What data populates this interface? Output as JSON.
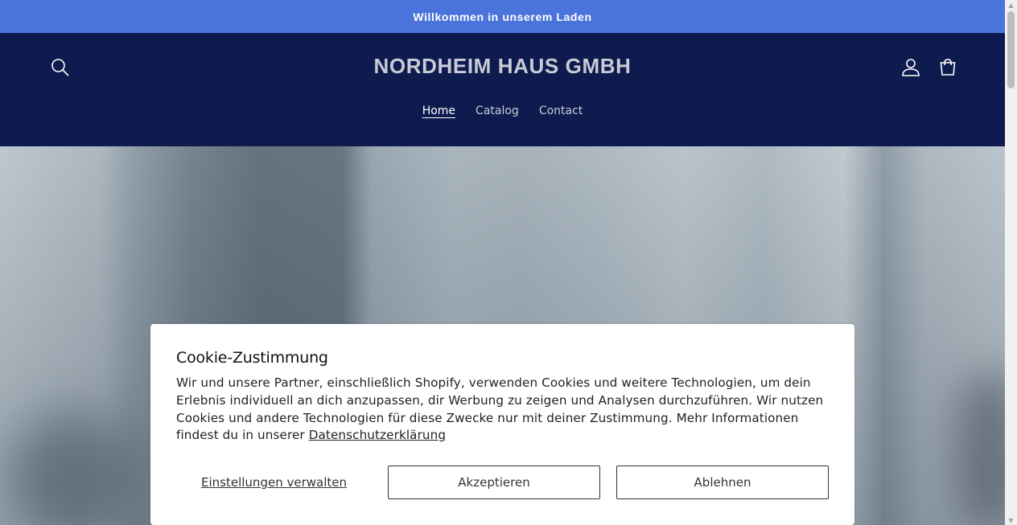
{
  "announcement": {
    "text": "Willkommen in unserem Laden"
  },
  "header": {
    "logo": "NORDHEIM HAUS GMBH",
    "icons": {
      "search": "search-icon",
      "account": "account-icon",
      "cart": "cart-icon"
    }
  },
  "nav": {
    "items": [
      {
        "label": "Home",
        "active": true
      },
      {
        "label": "Catalog",
        "active": false
      },
      {
        "label": "Contact",
        "active": false
      }
    ]
  },
  "cookie": {
    "title": "Cookie-Zustimmung",
    "body": "Wir und unsere Partner, einschließlich Shopify, verwenden Cookies und weitere Technologien, um dein Erlebnis individuell an dich anzupassen, dir Werbung zu zeigen und Analysen durchzuführen. Wir nutzen Cookies und andere Technologien für diese Zwecke nur mit deiner Zustimmung. Mehr Informationen findest du in unserer",
    "privacy_link": "Datenschutzerklärung",
    "manage_label": "Einstellungen verwalten",
    "accept_label": "Akzeptieren",
    "decline_label": "Ablehnen"
  },
  "colors": {
    "announcement_bg": "#4a74db",
    "header_bg": "#0e1b4f",
    "logo_text": "#c9cbd6"
  }
}
